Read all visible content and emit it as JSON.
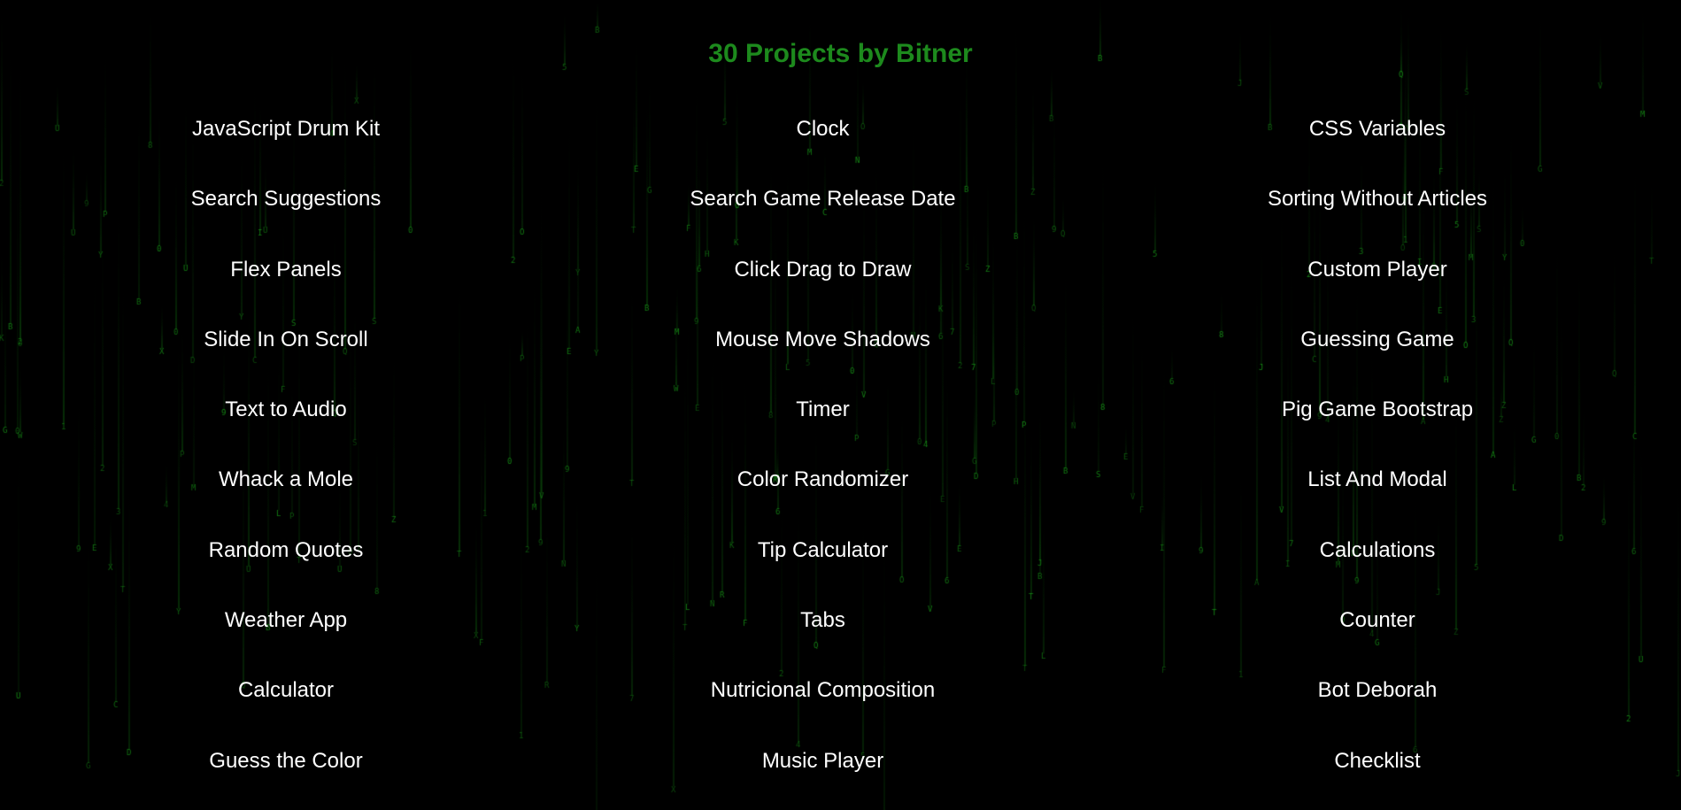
{
  "page": {
    "title": "30 Projects by Bitner"
  },
  "colors": {
    "background": "#000000",
    "accent": "#1d8a1d",
    "link": "#ffffff",
    "matrix_glyph": "#1aa81a"
  },
  "projects": [
    "JavaScript Drum Kit",
    "Clock",
    "CSS Variables",
    "Search Suggestions",
    "Search Game Release Date",
    "Sorting Without Articles",
    "Flex Panels",
    "Click Drag to Draw",
    "Custom Player",
    "Slide In On Scroll",
    "Mouse Move Shadows",
    "Guessing Game",
    "Text to Audio",
    "Timer",
    "Pig Game Bootstrap",
    "Whack a Mole",
    "Color Randomizer",
    "List And Modal",
    "Random Quotes",
    "Tip Calculator",
    "Calculations",
    "Weather App",
    "Tabs",
    "Counter",
    "Calculator",
    "Nutricional Composition",
    "Bot Deborah",
    "Guess the Color",
    "Music Player",
    "Checklist"
  ]
}
